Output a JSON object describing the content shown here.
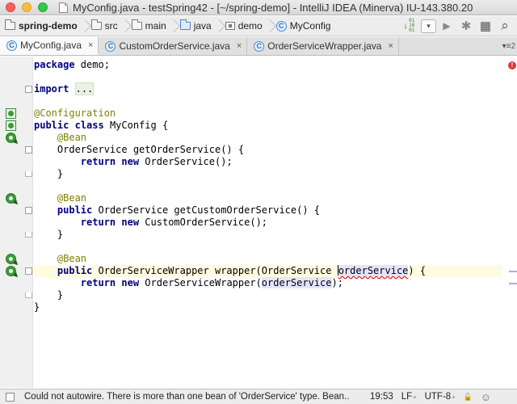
{
  "window": {
    "title": "MyConfig.java - testSpring42 - [~/spring-demo] - IntelliJ IDEA (Minerva) IU-143.380.20"
  },
  "breadcrumbs": [
    {
      "label": "spring-demo",
      "icon": "module-folder-icon",
      "bold": true
    },
    {
      "label": "src",
      "icon": "folder-icon"
    },
    {
      "label": "main",
      "icon": "folder-icon"
    },
    {
      "label": "java",
      "icon": "source-folder-icon"
    },
    {
      "label": "demo",
      "icon": "package-icon"
    },
    {
      "label": "MyConfig",
      "icon": "class-icon"
    }
  ],
  "toolbar": {
    "binary_digits": "01 10 01",
    "dropdown_glyph": "▾",
    "run_glyph": "▶",
    "debug_glyph": "✱",
    "structure_glyph": "▦",
    "search_glyph": "⌕"
  },
  "tabs": [
    {
      "label": "MyConfig.java",
      "active": true
    },
    {
      "label": "CustomOrderService.java",
      "active": false
    },
    {
      "label": "OrderServiceWrapper.java",
      "active": false
    }
  ],
  "tab_close_glyph": "×",
  "tab_overflow": {
    "glyph": "▾≡",
    "count": "2"
  },
  "icon_letters": {
    "class": "C"
  },
  "editor": {
    "lines": [
      [
        {
          "t": "package",
          "c": "kw"
        },
        {
          "t": " demo;"
        }
      ],
      [],
      [
        {
          "t": "import",
          "c": "kw"
        },
        {
          "t": " "
        },
        {
          "t": "...",
          "c": "fold-dots"
        }
      ],
      [],
      [
        {
          "t": "@Configuration",
          "c": "ann"
        }
      ],
      [
        {
          "t": "public",
          "c": "kw"
        },
        {
          "t": " "
        },
        {
          "t": "class",
          "c": "kw"
        },
        {
          "t": " MyConfig {"
        }
      ],
      [
        {
          "t": "    "
        },
        {
          "t": "@Bean",
          "c": "ann"
        }
      ],
      [
        {
          "t": "    OrderService getOrderService() {"
        }
      ],
      [
        {
          "t": "        "
        },
        {
          "t": "return",
          "c": "kw"
        },
        {
          "t": " "
        },
        {
          "t": "new",
          "c": "kw"
        },
        {
          "t": " OrderService();"
        }
      ],
      [
        {
          "t": "    }"
        }
      ],
      [],
      [
        {
          "t": "    "
        },
        {
          "t": "@Bean",
          "c": "ann"
        }
      ],
      [
        {
          "t": "    "
        },
        {
          "t": "public",
          "c": "kw"
        },
        {
          "t": " OrderService getCustomOrderService() {"
        }
      ],
      [
        {
          "t": "        "
        },
        {
          "t": "return",
          "c": "kw"
        },
        {
          "t": " "
        },
        {
          "t": "new",
          "c": "kw"
        },
        {
          "t": " CustomOrderService();"
        }
      ],
      [
        {
          "t": "    }"
        }
      ],
      [],
      [
        {
          "t": "    "
        },
        {
          "t": "@Bean",
          "c": "ann"
        }
      ],
      [
        {
          "t": "    "
        },
        {
          "t": "public",
          "c": "kw"
        },
        {
          "t": " OrderServiceWrapper wrapper(OrderService "
        },
        {
          "t": "",
          "c": "caret"
        },
        {
          "t": "orderService",
          "c": "param-hl param-err"
        },
        {
          "t": ") {"
        }
      ],
      [
        {
          "t": "        "
        },
        {
          "t": "return",
          "c": "kw"
        },
        {
          "t": " "
        },
        {
          "t": "new",
          "c": "kw"
        },
        {
          "t": " OrderServiceWrapper("
        },
        {
          "t": "orderService",
          "c": "param-hl"
        },
        {
          "t": ");"
        }
      ],
      [
        {
          "t": "    }"
        }
      ],
      [
        {
          "t": "}"
        }
      ]
    ],
    "current_line": 17
  },
  "gutter": {
    "marks": [
      {
        "line": 4,
        "icon": "spring-config-icon"
      },
      {
        "line": 5,
        "icon": "spring-context-icon"
      },
      {
        "line": 6,
        "icon": "spring-bean-icon"
      },
      {
        "line": 11,
        "icon": "spring-bean-icon"
      },
      {
        "line": 16,
        "icon": "spring-bean-icon"
      },
      {
        "line": 17,
        "icon": "spring-bean-autowire-icon"
      }
    ],
    "fold_open_lines": [
      2,
      7,
      12,
      17
    ],
    "fold_close_lines": [
      9,
      14,
      19
    ]
  },
  "error_stripe_glyph": "!",
  "statusbar": {
    "message": "Could not autowire. There is more than one bean of 'OrderService' type. Bean..",
    "position": "19:53",
    "line_separator": "LF",
    "encoding": "UTF-8",
    "dropdown_glyph": "÷",
    "lock_glyph": "🔓",
    "inspector_glyph": "☺"
  }
}
